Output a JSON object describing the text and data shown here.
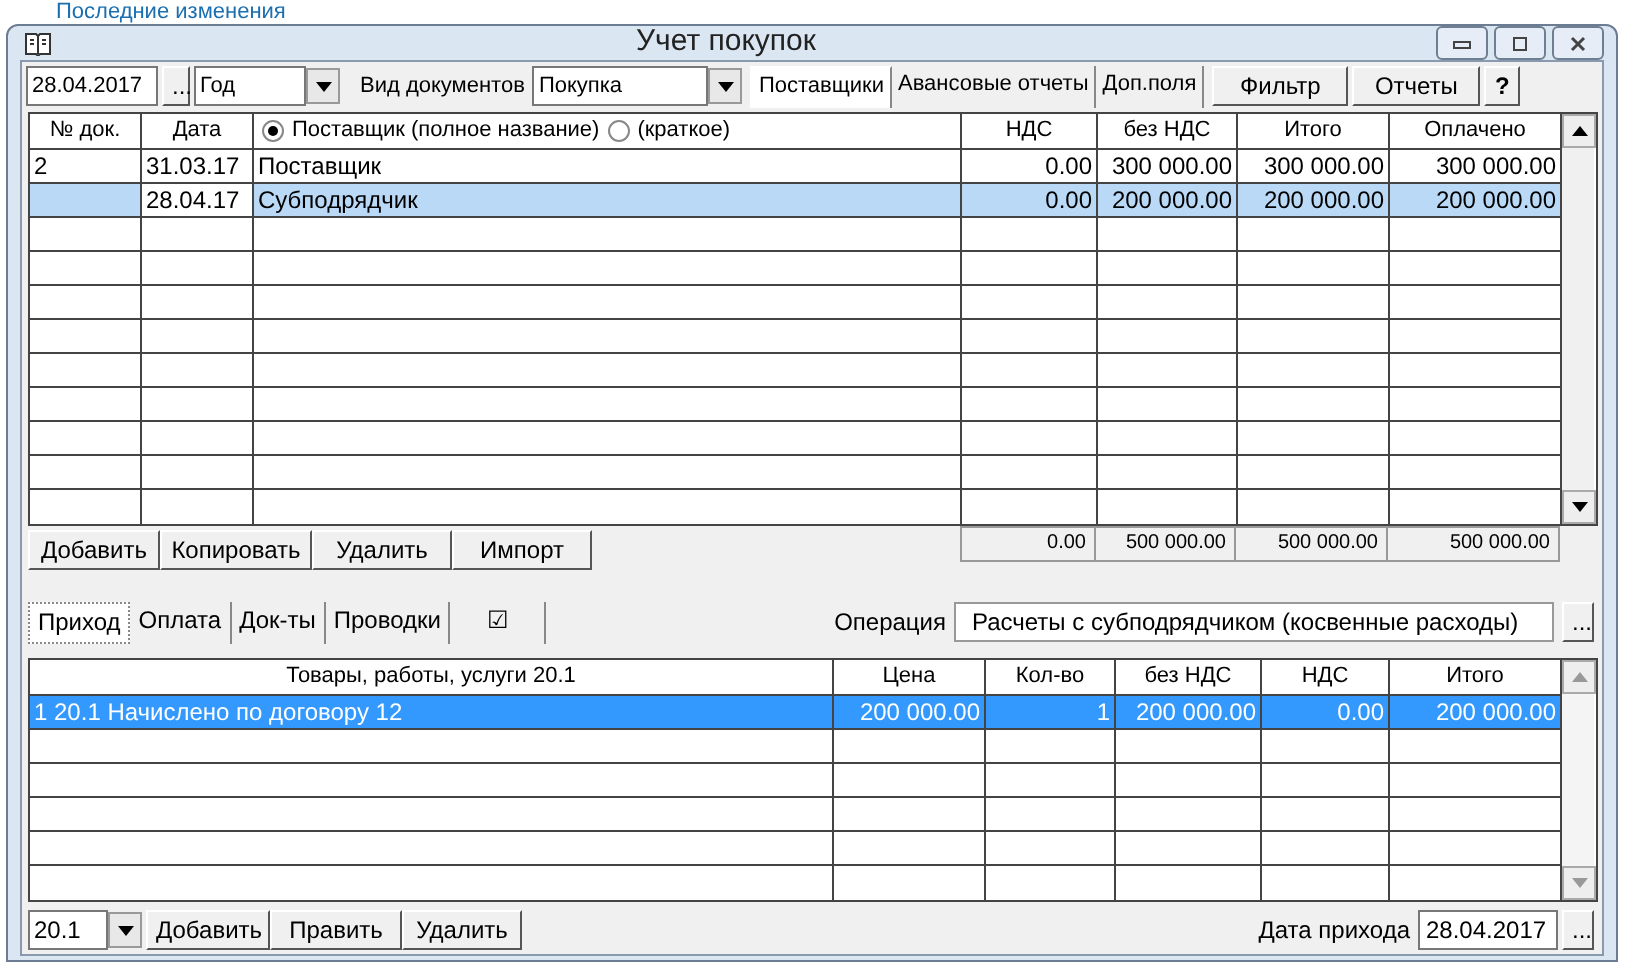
{
  "background_link": "Последние изменения",
  "window": {
    "title": "Учет покупок"
  },
  "toolbar": {
    "date": "28.04.2017",
    "date_button": "...",
    "period": "Год",
    "doc_type_label": "Вид документов",
    "doc_type": "Покупка",
    "tabs": [
      {
        "label": "Поставщики",
        "selected": true
      },
      {
        "label": "Авансовые отчеты",
        "selected": false
      },
      {
        "label": "Доп.поля",
        "selected": false
      }
    ],
    "buttons": [
      "Фильтр",
      "Отчеты",
      "?"
    ]
  },
  "purchases_table": {
    "columns": [
      "№ док.",
      "Дата",
      null,
      "НДС",
      "без НДС",
      "Итого",
      "Оплачено"
    ],
    "name_options": [
      {
        "label": "Поставщик (полное название)",
        "selected": true
      },
      {
        "label": "(краткое)",
        "selected": false
      }
    ],
    "rows": [
      {
        "cells": [
          "2",
          "31.03.17",
          "Поставщик",
          "0.00",
          "300 000.00",
          "300 000.00",
          "300 000.00"
        ],
        "selected": false
      },
      {
        "cells": [
          "",
          "28.04.17",
          "Субподрядчик",
          "0.00",
          "200 000.00",
          "200 000.00",
          "200 000.00"
        ],
        "selected": true
      }
    ],
    "totals": [
      "0.00",
      "500 000.00",
      "500 000.00",
      "500 000.00"
    ]
  },
  "table_buttons": [
    "Добавить",
    "Копировать",
    "Удалить",
    "Импорт"
  ],
  "detail_tabs": [
    {
      "label": "Приход",
      "selected": true
    },
    {
      "label": "Оплата",
      "selected": false
    },
    {
      "label": "Док-ты",
      "selected": false
    },
    {
      "label": "Проводки",
      "selected": false
    },
    {
      "label": "☑",
      "selected": false
    }
  ],
  "operation": {
    "label": "Операция",
    "value": "Расчеты с субподрядчиком (косвенные расходы)",
    "button": "..."
  },
  "items_table": {
    "columns": [
      "Товары, работы, услуги 20.1",
      "Цена",
      "Кол-во",
      "без НДС",
      "НДС",
      "Итого"
    ],
    "rows": [
      {
        "cells": [
          "1 20.1 Начислено по договору 12",
          "200 000.00",
          "1",
          "200 000.00",
          "0.00",
          "200 000.00"
        ],
        "selected": true
      }
    ]
  },
  "bottom": {
    "account": "20.1",
    "buttons": [
      "Добавить",
      "Править",
      "Удалить"
    ],
    "date_label": "Дата прихода",
    "date": "28.04.2017",
    "date_button": "..."
  }
}
